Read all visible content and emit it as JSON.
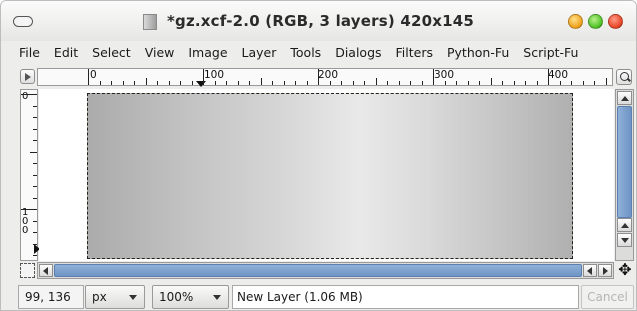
{
  "window": {
    "title": "*gz.xcf-2.0 (RGB, 3 layers) 420x145"
  },
  "menubar": {
    "items": [
      {
        "label": "File"
      },
      {
        "label": "Edit"
      },
      {
        "label": "Select"
      },
      {
        "label": "View"
      },
      {
        "label": "Image"
      },
      {
        "label": "Layer"
      },
      {
        "label": "Tools"
      },
      {
        "label": "Dialogs"
      },
      {
        "label": "Filters"
      },
      {
        "label": "Python-Fu"
      },
      {
        "label": "Script-Fu"
      }
    ]
  },
  "rulers": {
    "horizontal_labels": [
      "0",
      "100",
      "200",
      "300",
      "400"
    ],
    "vertical_labels": [
      "0",
      "1",
      "0",
      "0"
    ]
  },
  "statusbar": {
    "coords": "99, 136",
    "unit": "px",
    "zoom": "100%",
    "message": "New Layer (1.06 MB)",
    "cancel_label": "Cancel"
  },
  "icons": {
    "window_menu": "window-menu-icon",
    "navigate": "navigate-icon",
    "zoom_fit": "zoom-icon",
    "quick_mask": "quick-mask-icon",
    "move": "move-icon"
  },
  "colors": {
    "scrollbar_thumb": "#7aa0cf",
    "selection_outline": "#c7b400",
    "minimize": "#f0a320",
    "maximize": "#55c52b",
    "close": "#e9482a"
  }
}
